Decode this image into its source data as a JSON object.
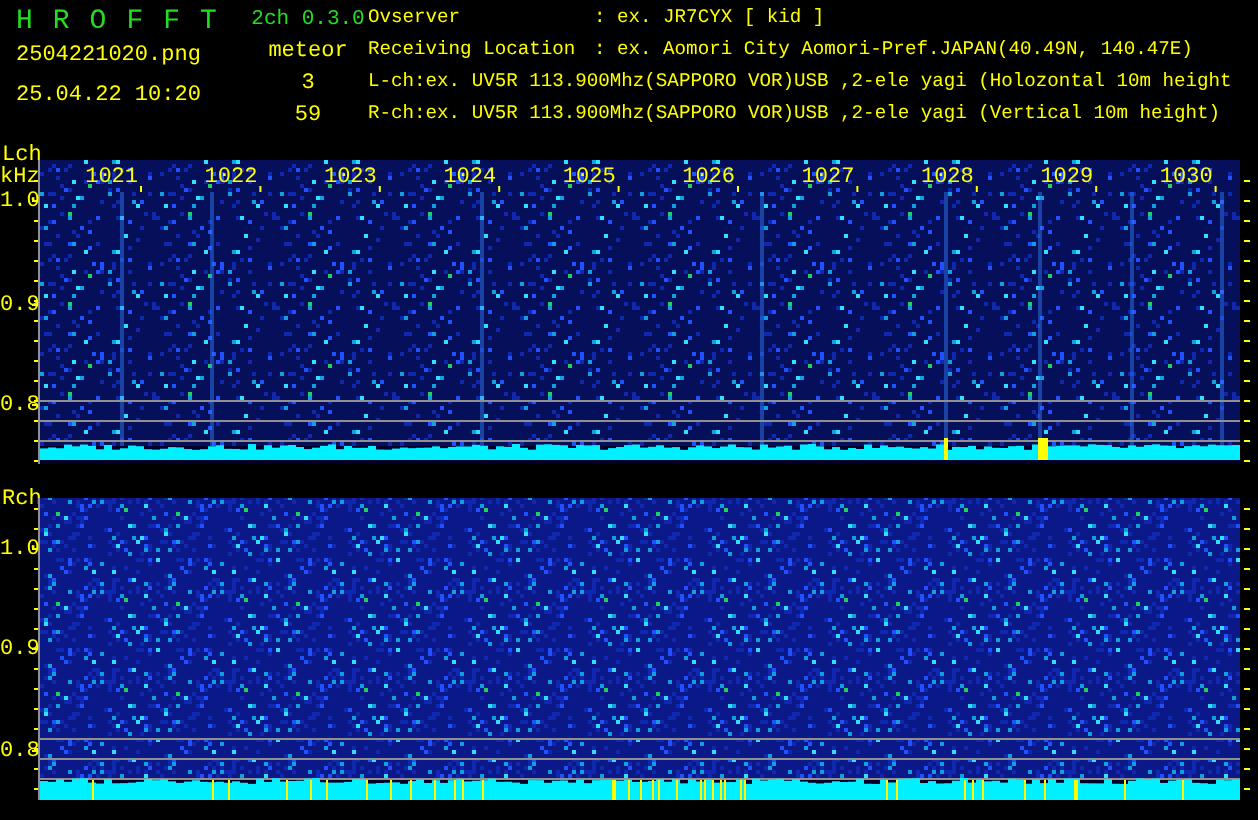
{
  "header": {
    "title": "HROFFT",
    "version": "2ch 0.3.0",
    "filename": "2504221020.png",
    "datetime": "25.04.22 10:20",
    "meteor_label": "meteor",
    "meteor_counts": [
      "3",
      "59"
    ]
  },
  "info": [
    {
      "label": "Ovserver",
      "value": ": ex. JR7CYX [ kid ]"
    },
    {
      "label": "Receiving Location",
      "value": ": ex. Aomori City Aomori-Pref.JAPAN(40.49N, 140.47E)"
    },
    {
      "value": "L-ch:ex. UV5R 113.900Mhz(SAPPORO VOR)USB ,2-ele yagi (Holozontal 10m height"
    },
    {
      "value": "R-ch:ex. UV5R 113.900Mhz(SAPPORO VOR)USB ,2-ele yagi (Vertical 10m height)"
    }
  ],
  "channels": [
    {
      "label": "Lch",
      "unit": "kHz",
      "x_ticks": [
        "1021",
        "1022",
        "1023",
        "1024",
        "1025",
        "1026",
        "1027",
        "1028",
        "1029",
        "1030"
      ],
      "y_ticks": [
        "1.0",
        "0.9",
        "0.8"
      ]
    },
    {
      "label": "Rch",
      "y_ticks": [
        "1.0",
        "0.9",
        "0.8"
      ]
    }
  ]
}
